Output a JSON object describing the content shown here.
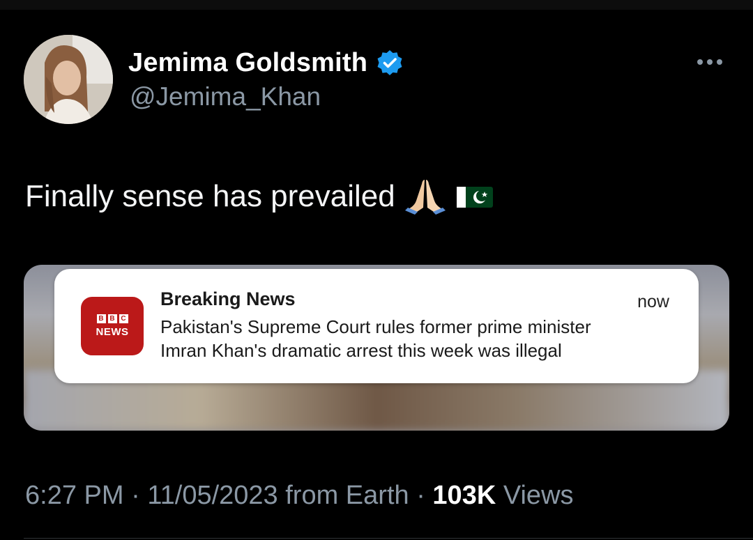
{
  "tweet": {
    "author": {
      "display_name": "Jemima Goldsmith",
      "handle": "@Jemima_Khan",
      "verified": true
    },
    "text": "Finally sense has prevailed",
    "emojis": [
      "folded-hands-icon",
      "pakistan-flag-icon"
    ],
    "media": {
      "notification": {
        "app_icon": "bbc-news-icon",
        "app_icon_blocks": [
          "B",
          "B",
          "C"
        ],
        "app_icon_label": "NEWS",
        "title": "Breaking News",
        "time": "now",
        "body_line1": "Pakistan's Supreme Court rules former prime minister",
        "body_line2": "Imran Khan's dramatic arrest this week was illegal"
      }
    },
    "meta": {
      "time": "6:27 PM",
      "separator": "·",
      "date": "11/05/2023",
      "source": "from Earth",
      "views_count": "103K",
      "views_label": "Views"
    }
  },
  "colors": {
    "background": "#000000",
    "verified": "#1d9bf0",
    "bbc_red": "#bb1919",
    "secondary_text": "#8b98a5"
  }
}
